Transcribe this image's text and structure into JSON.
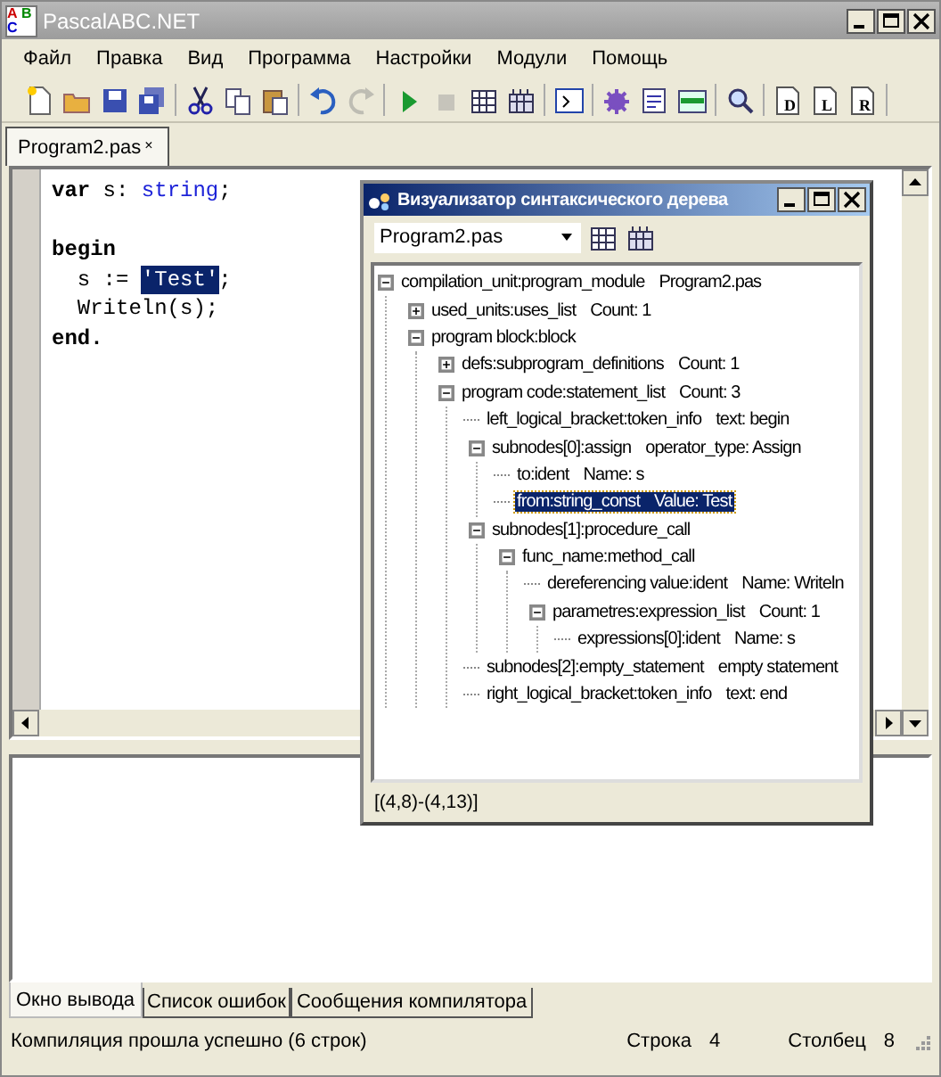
{
  "window": {
    "title": "PascalABC.NET",
    "logo_letters": [
      "A",
      "B",
      "C"
    ]
  },
  "menu": [
    "Файл",
    "Правка",
    "Вид",
    "Программа",
    "Настройки",
    "Модули",
    "Помощь"
  ],
  "toolbar": [
    [
      {
        "kind": "new",
        "disabled": false
      },
      {
        "kind": "open",
        "disabled": false
      },
      {
        "kind": "save",
        "disabled": false
      },
      {
        "kind": "saveall",
        "disabled": false
      }
    ],
    [
      {
        "kind": "cut",
        "disabled": false
      },
      {
        "kind": "copy",
        "disabled": false
      },
      {
        "kind": "paste",
        "disabled": false
      }
    ],
    [
      {
        "kind": "undo",
        "disabled": false
      },
      {
        "kind": "redo",
        "disabled": true
      }
    ],
    [
      {
        "kind": "run",
        "disabled": false
      },
      {
        "kind": "stop",
        "disabled": true
      },
      {
        "kind": "grid",
        "disabled": false
      },
      {
        "kind": "grid2",
        "disabled": false
      }
    ],
    [
      {
        "kind": "console",
        "disabled": false
      }
    ],
    [
      {
        "kind": "gear",
        "disabled": false
      },
      {
        "kind": "form",
        "disabled": false
      },
      {
        "kind": "panel",
        "disabled": false
      }
    ],
    [
      {
        "kind": "magnifier",
        "disabled": false
      }
    ],
    [
      {
        "kind": "doc",
        "letter": "D",
        "disabled": false
      },
      {
        "kind": "doc",
        "letter": "L",
        "disabled": false
      },
      {
        "kind": "doc",
        "letter": "R",
        "disabled": false
      }
    ]
  ],
  "tabs": [
    {
      "label": "Program2.pas",
      "close": "×",
      "selected": true
    }
  ],
  "code": [
    {
      "kind": "code",
      "tokens": [
        {
          "text": "var",
          "kind": "keyword"
        },
        {
          "text": " s: ",
          "kind": "plain"
        },
        {
          "text": "string",
          "kind": "type"
        },
        {
          "text": ";",
          "kind": "plain"
        }
      ]
    },
    {
      "kind": "blank"
    },
    {
      "kind": "code",
      "tokens": [
        {
          "text": "begin",
          "kind": "keyword"
        }
      ]
    },
    {
      "kind": "code",
      "tokens": [
        {
          "text": "  s := ",
          "kind": "plain"
        },
        {
          "text": "'Test'",
          "kind": "selection"
        },
        {
          "text": ";",
          "kind": "plain"
        }
      ]
    },
    {
      "kind": "code",
      "tokens": [
        {
          "text": "  Writeln(s);",
          "kind": "plain"
        }
      ]
    },
    {
      "kind": "code",
      "tokens": [
        {
          "text": "end.",
          "kind": "keyword"
        }
      ]
    }
  ],
  "tree_window": {
    "title": "Визуализатор синтаксического дерева",
    "file": "Program2.pas",
    "status": "[(4,8)-(4,13)]",
    "tree": [
      {
        "name": "compilation_unit:program_module",
        "value": "Program2.pas",
        "expanded": true,
        "selected": false,
        "children": [
          {
            "name": "used_units:uses_list",
            "value": "Count: 1",
            "expanded": false,
            "selected": false
          },
          {
            "name": "program block:block",
            "expanded": true,
            "selected": false,
            "children": [
              {
                "name": "defs:subprogram_definitions",
                "value": "Count: 1",
                "expanded": false,
                "selected": false
              },
              {
                "name": "program code:statement_list",
                "value": "Count: 3",
                "expanded": true,
                "selected": false,
                "children": [
                  {
                    "name": "left_logical_bracket:token_info",
                    "value": "text: begin",
                    "selected": false
                  },
                  {
                    "name": "subnodes[0]:assign",
                    "value": "operator_type: Assign",
                    "expanded": true,
                    "selected": false,
                    "children": [
                      {
                        "name": "to:ident",
                        "value": "Name: s",
                        "selected": false
                      },
                      {
                        "name": "from:string_const",
                        "value": "Value: Test",
                        "selected": true
                      }
                    ]
                  },
                  {
                    "name": "subnodes[1]:procedure_call",
                    "expanded": true,
                    "selected": false,
                    "children": [
                      {
                        "name": "func_name:method_call",
                        "expanded": true,
                        "selected": false,
                        "children": [
                          {
                            "name": "dereferencing value:ident",
                            "value": "Name: Writeln",
                            "selected": false
                          },
                          {
                            "name": "parametres:expression_list",
                            "value": "Count: 1",
                            "expanded": true,
                            "selected": false,
                            "children": [
                              {
                                "name": "expressions[0]:ident",
                                "value": "Name: s",
                                "selected": false
                              }
                            ]
                          }
                        ]
                      }
                    ]
                  },
                  {
                    "name": "subnodes[2]:empty_statement",
                    "value": "empty statement",
                    "selected": false
                  },
                  {
                    "name": "right_logical_bracket:token_info",
                    "value": "text: end",
                    "selected": false
                  }
                ]
              }
            ]
          }
        ]
      }
    ]
  },
  "bottom_tabs": [
    {
      "label": "Окно вывода",
      "selected": true
    },
    {
      "label": "Список ошибок",
      "selected": false
    },
    {
      "label": "Сообщения компилятора",
      "selected": false
    }
  ],
  "status_bar": {
    "message": "Компиляция прошла успешно (6 строк)",
    "line_label": "Строка",
    "line": "4",
    "column_label": "Столбец",
    "column": "8"
  }
}
